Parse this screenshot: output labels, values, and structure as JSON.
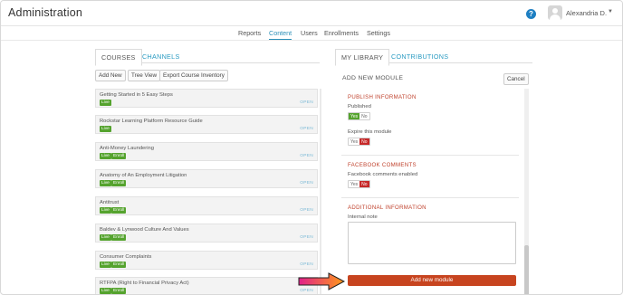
{
  "header": {
    "title": "Administration",
    "help_icon": "?",
    "user_name": "Alexandria D.",
    "caret": "▼"
  },
  "nav": {
    "items": [
      "Reports",
      "Content",
      "Users",
      "Enrollments",
      "Settings"
    ],
    "active": "Content"
  },
  "left_panel": {
    "tabs": [
      "COURSES",
      "CHANNELS"
    ],
    "buttons": [
      "Add New",
      "Tree View",
      "Export Course Inventory"
    ],
    "open_label": "OPEN",
    "courses": [
      {
        "title": "Getting Started in 5 Easy Steps",
        "badges": [
          "Live"
        ]
      },
      {
        "title": "Rockstar Learning Platform Resource Guide",
        "badges": [
          "Live"
        ]
      },
      {
        "title": "Anti-Money Laundering",
        "badges": [
          "Live",
          "Enroll"
        ]
      },
      {
        "title": "Anatomy of An Employment Litigation",
        "badges": [
          "Live",
          "Enroll"
        ]
      },
      {
        "title": "Antitrust",
        "badges": [
          "Live",
          "Enroll"
        ]
      },
      {
        "title": "Baldev & Lynwood Culture And Values",
        "badges": [
          "Live",
          "Enroll"
        ]
      },
      {
        "title": "Consumer Complaints",
        "badges": [
          "Live",
          "Enroll"
        ]
      },
      {
        "title": "RTFPA (Right to Financial Privacy Act)",
        "badges": [
          "Live",
          "Enroll"
        ]
      }
    ]
  },
  "right_panel": {
    "tabs": [
      "MY LIBRARY",
      "CONTRIBUTIONS"
    ],
    "heading": "ADD NEW MODULE",
    "cancel_label": "Cancel",
    "publish_section": "PUBLISH INFORMATION",
    "published_label": "Published",
    "expire_label": "Expire this module",
    "facebook_section": "FACEBOOK COMMENTS",
    "facebook_label": "Facebook comments enabled",
    "additional_section": "ADDITIONAL INFORMATION",
    "internal_note_label": "Internal note",
    "internal_note_value": "",
    "yes": "Yes",
    "no": "No",
    "submit_label": "Add new module"
  },
  "colors": {
    "accent": "#2a8fb8",
    "live_badge": "#55a32e",
    "section_title": "#c0432e",
    "submit": "#c7441f",
    "toggle_no": "#c62828"
  }
}
